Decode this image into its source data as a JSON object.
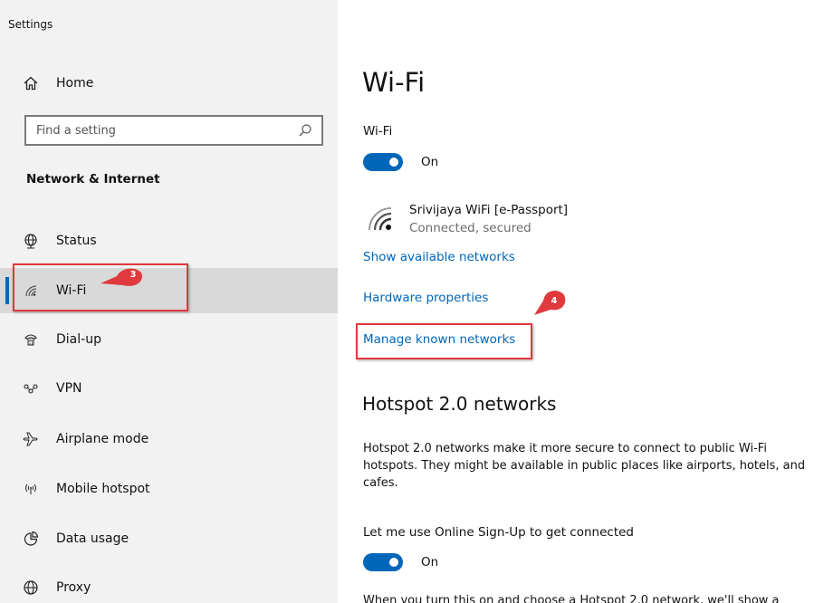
{
  "window": {
    "title": "Settings"
  },
  "sidebar": {
    "home_label": "Home",
    "search": {
      "placeholder": "Find a setting",
      "icon": "search-icon"
    },
    "section_heading": "Network & Internet",
    "items": [
      {
        "label": "Status",
        "icon": "status-globe-icon"
      },
      {
        "label": "Wi-Fi",
        "icon": "wifi-icon",
        "selected": true
      },
      {
        "label": "Dial-up",
        "icon": "dialup-icon"
      },
      {
        "label": "VPN",
        "icon": "vpn-icon"
      },
      {
        "label": "Airplane mode",
        "icon": "airplane-icon"
      },
      {
        "label": "Mobile hotspot",
        "icon": "mobile-hotspot-icon"
      },
      {
        "label": "Data usage",
        "icon": "data-usage-icon"
      },
      {
        "label": "Proxy",
        "icon": "proxy-globe-icon"
      }
    ],
    "annotation_badge": "3"
  },
  "main": {
    "title": "Wi-Fi",
    "wifi_label": "Wi-Fi",
    "wifi_toggle": {
      "state": "On",
      "on": true
    },
    "network": {
      "name": "Srivijaya WiFi [e-Passport]",
      "status": "Connected, secured"
    },
    "links": {
      "show_available": "Show available networks",
      "hardware_properties": "Hardware properties",
      "manage_known": "Manage known networks"
    },
    "annotation_badge": "4",
    "hotspot": {
      "title": "Hotspot 2.0 networks",
      "description": "Hotspot 2.0 networks make it more secure to connect to public Wi-Fi hotspots. They might be available in public places like airports, hotels, and cafes.",
      "signup_label": "Let me use Online Sign-Up to get connected",
      "signup_toggle": {
        "state": "On",
        "on": true
      },
      "footer_text": "When you turn this on and choose a Hotspot 2.0 network, we'll show a"
    }
  },
  "colors": {
    "accent": "#0067b8",
    "callout": "#e0393e",
    "sidebar_bg": "#f2f2f2",
    "selected_bg": "#d9d9d9"
  }
}
